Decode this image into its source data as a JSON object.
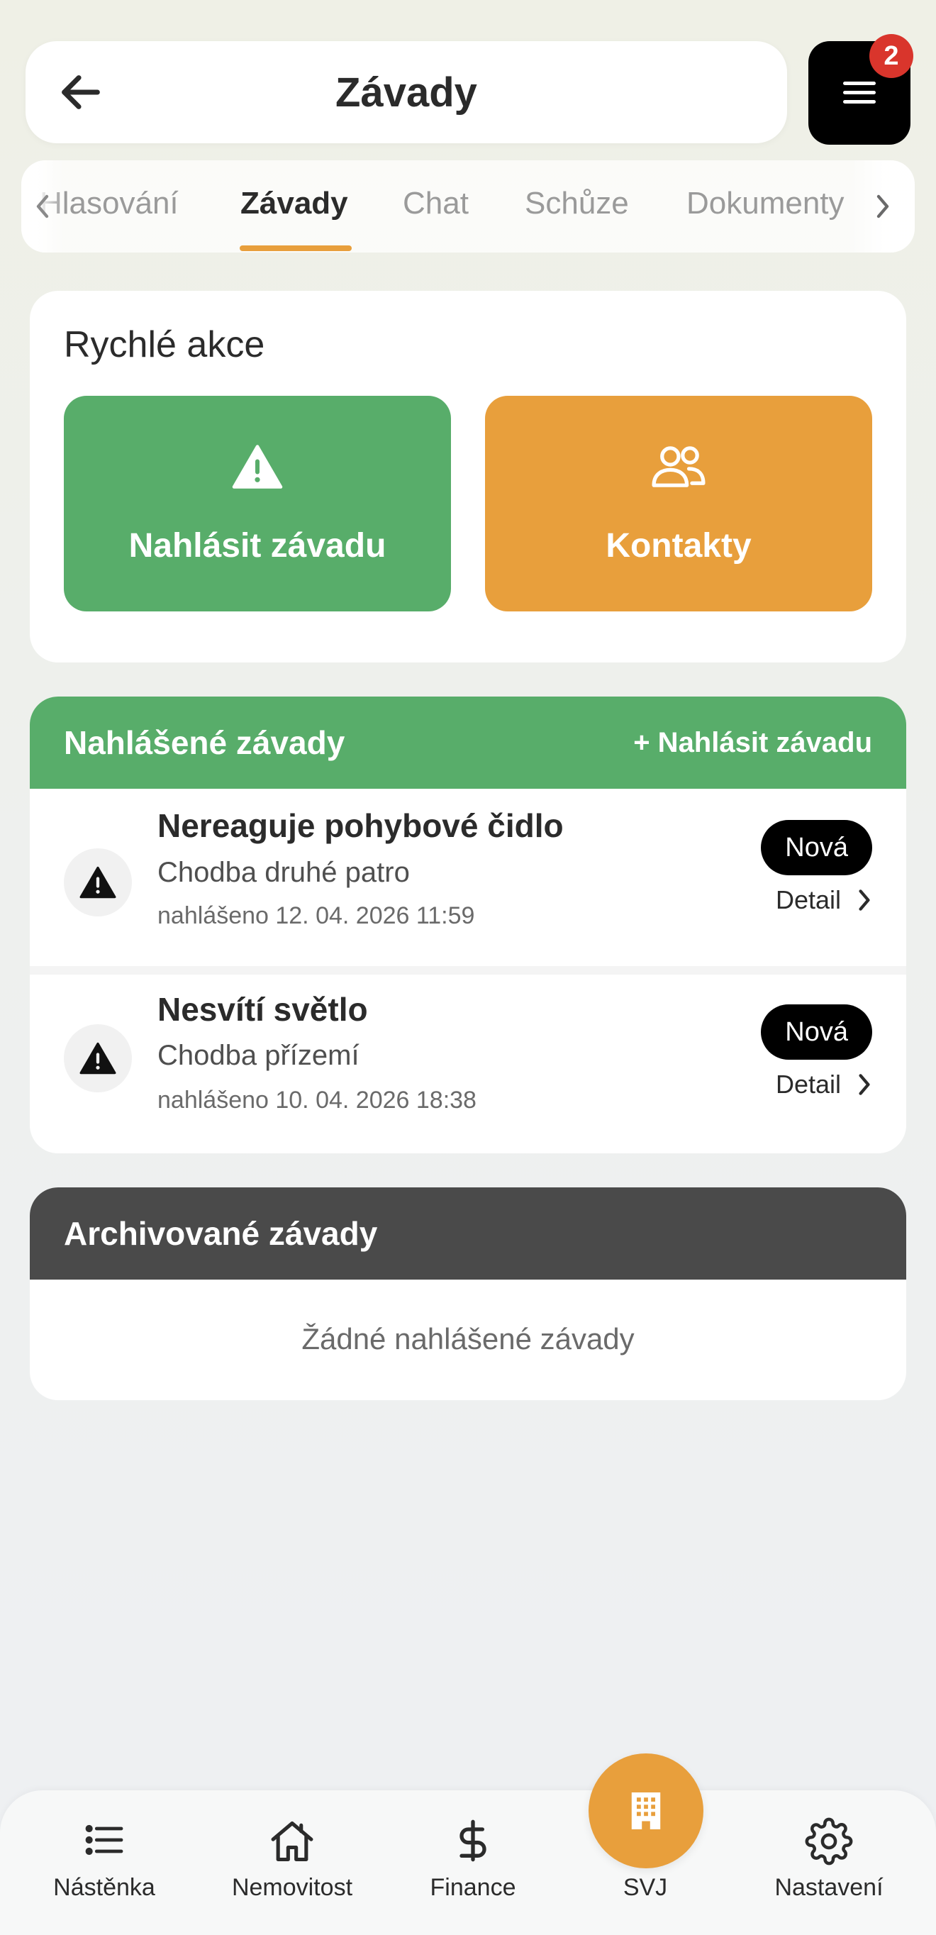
{
  "header": {
    "title": "Závady",
    "menu_badge_count": "2"
  },
  "tabs": [
    {
      "label": "Hlasování",
      "active": false
    },
    {
      "label": "Závady",
      "active": true
    },
    {
      "label": "Chat",
      "active": false
    },
    {
      "label": "Schůze",
      "active": false
    },
    {
      "label": "Dokumenty",
      "active": false
    }
  ],
  "quick_actions": {
    "title": "Rychlé akce",
    "report_label": "Nahlásit závadu",
    "contacts_label": "Kontakty"
  },
  "reported": {
    "title": "Nahlášené závady",
    "add_label": "+ Nahlásit závadu",
    "items": [
      {
        "title": "Nereaguje pohybové čidlo",
        "location": "Chodba druhé patro",
        "date": "nahlášeno 12. 04. 2026 11:59",
        "status": "Nová",
        "detail": "Detail"
      },
      {
        "title": "Nesvítí světlo",
        "location": "Chodba přízemí",
        "date": "nahlášeno 10. 04. 2026 18:38",
        "status": "Nová",
        "detail": "Detail"
      }
    ]
  },
  "archived": {
    "title": "Archivované závady",
    "empty": "Žádné nahlášené závady"
  },
  "bottom_nav": [
    {
      "label": "Nástěnka",
      "icon": "list-icon"
    },
    {
      "label": "Nemovitost",
      "icon": "home-icon"
    },
    {
      "label": "Finance",
      "icon": "dollar-icon"
    },
    {
      "label": "SVJ",
      "icon": "building-icon",
      "active": true
    },
    {
      "label": "Nastavení",
      "icon": "gear-icon"
    }
  ],
  "colors": {
    "green": "#58ad6a",
    "orange": "#e89f3c",
    "dark": "#4a4a4a",
    "badge_red": "#d9352c"
  }
}
